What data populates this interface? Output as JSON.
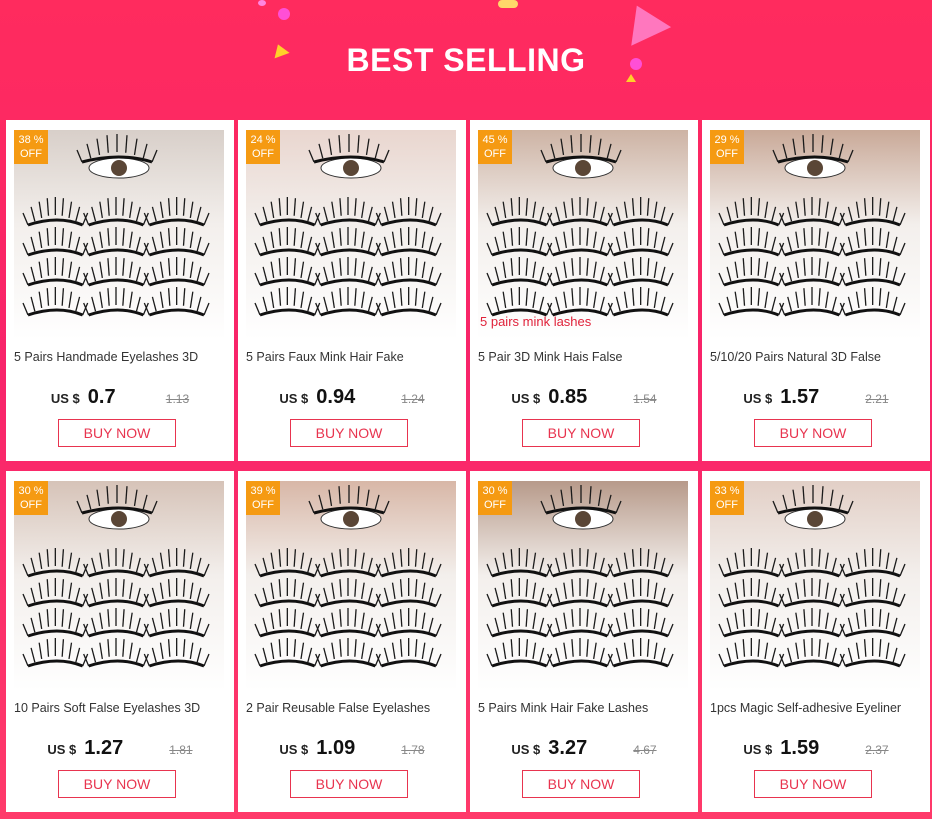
{
  "header": {
    "title": "BEST SELLING"
  },
  "products": [
    {
      "discount": "38 %",
      "off": "OFF",
      "title": "5 Pairs Handmade Eyelashes 3D",
      "currency": "US $",
      "price": "0.7",
      "old_price": "1.13",
      "buy": "BUY NOW",
      "photo_tone": "#d8cfc9",
      "photo_caption": ""
    },
    {
      "discount": "24 %",
      "off": "OFF",
      "title": "5 Pairs Faux Mink Hair Fake",
      "currency": "US $",
      "price": "0.94",
      "old_price": "1.24",
      "buy": "BUY NOW",
      "photo_tone": "#e9d6cf",
      "photo_caption": ""
    },
    {
      "discount": "45 %",
      "off": "OFF",
      "title": "5 Pair 3D Mink Hais False",
      "currency": "US $",
      "price": "0.85",
      "old_price": "1.54",
      "buy": "BUY NOW",
      "photo_tone": "#cdb3a4",
      "photo_caption": "5 pairs mink lashes"
    },
    {
      "discount": "29 %",
      "off": "OFF",
      "title": "5/10/20 Pairs Natural 3D False",
      "currency": "US $",
      "price": "1.57",
      "old_price": "2.21",
      "buy": "BUY NOW",
      "photo_tone": "#c9a998",
      "photo_caption": ""
    },
    {
      "discount": "30 %",
      "off": "OFF",
      "title": "10 Pairs Soft False Eyelashes 3D",
      "currency": "US $",
      "price": "1.27",
      "old_price": "1.81",
      "buy": "BUY NOW",
      "photo_tone": "#d6c3b8",
      "photo_caption": ""
    },
    {
      "discount": "39 %",
      "off": "OFF",
      "title": "2 Pair Reusable False Eyelashes",
      "currency": "US $",
      "price": "1.09",
      "old_price": "1.78",
      "buy": "BUY NOW",
      "photo_tone": "#d8b7a7",
      "photo_caption": ""
    },
    {
      "discount": "30 %",
      "off": "OFF",
      "title": "5 Pairs Mink Hair Fake Lashes",
      "currency": "US $",
      "price": "3.27",
      "old_price": "4.67",
      "buy": "BUY NOW",
      "photo_tone": "#b79a8a",
      "photo_caption": ""
    },
    {
      "discount": "33 %",
      "off": "OFF",
      "title": "1pcs Magic Self-adhesive Eyeliner",
      "currency": "US $",
      "price": "1.59",
      "old_price": "2.37",
      "buy": "BUY NOW",
      "photo_tone": "#e2cfc6",
      "photo_caption": ""
    }
  ],
  "colors": {
    "accent": "#e8344f",
    "badge": "#f59a12",
    "background": "#ff2b5e"
  }
}
